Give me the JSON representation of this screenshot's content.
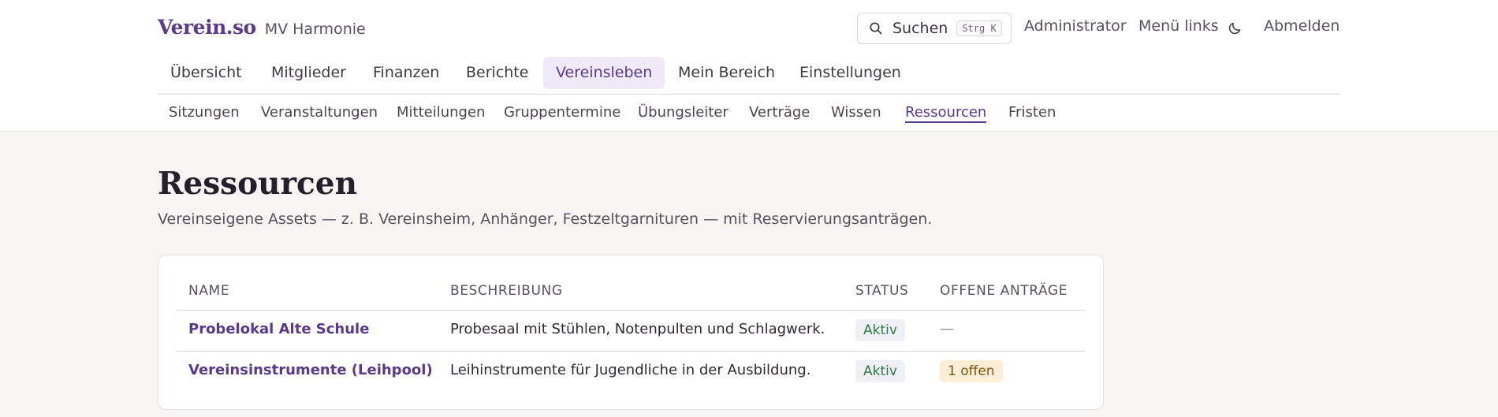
{
  "brand": {
    "logo": "Verein.so",
    "org": "MV Harmonie"
  },
  "header": {
    "search_label": "Suchen",
    "search_shortcut": "Strg K",
    "admin_label": "Administrator",
    "menu_label": "Menü links",
    "logout_label": "Abmelden"
  },
  "main_nav": {
    "tabs": [
      "Übersicht",
      "Mitglieder",
      "Finanzen",
      "Berichte",
      "Vereinsleben",
      "Mein Bereich",
      "Einstellungen"
    ],
    "active": "Vereinsleben"
  },
  "sub_nav": {
    "items": [
      "Sitzungen",
      "Veranstaltungen",
      "Mitteilungen",
      "Gruppentermine",
      "Übungsleiter",
      "Verträge",
      "Wissen",
      "Ressourcen",
      "Fristen"
    ],
    "active": "Ressourcen"
  },
  "page": {
    "title": "Ressourcen",
    "description": "Vereinseigene Assets — z. B. Vereinsheim, Anhänger, Festzeltgarnituren — mit Reservierungsanträgen."
  },
  "table": {
    "headers": [
      "NAME",
      "BESCHREIBUNG",
      "STATUS",
      "OFFENE ANTRÄGE"
    ],
    "rows": [
      {
        "name": "Probelokal Alte Schule",
        "description": "Probesaal mit Stühlen, Notenpulten und Schlagwerk.",
        "status": "Aktiv",
        "open_requests": "—"
      },
      {
        "name": "Vereinsinstrumente (Leihpool)",
        "description": "Leihinstrumente für Jugendliche in der Ausbildung.",
        "status": "Aktiv",
        "open_requests": "1 offen"
      }
    ]
  },
  "colors": {
    "accent": "#5b3a8a",
    "active_tab_bg": "#efe9f8",
    "status_green": "#2f7a45",
    "pending_bg": "#fbeed5"
  },
  "icons": {
    "search": "search-icon",
    "theme": "moon-icon"
  }
}
